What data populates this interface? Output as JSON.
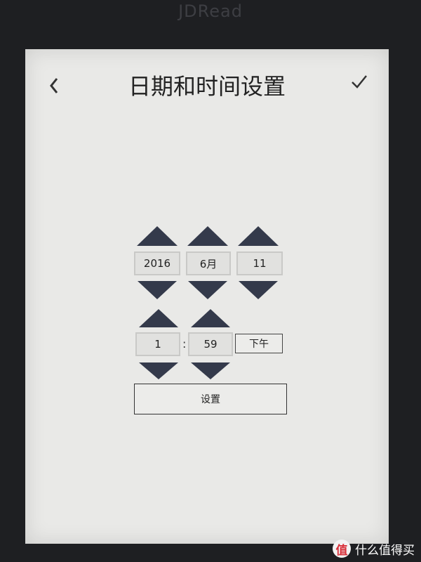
{
  "device": {
    "brand": "JDRead"
  },
  "header": {
    "title": "日期和时间设置"
  },
  "date": {
    "year": "2016",
    "month": "6月",
    "day": "11"
  },
  "time": {
    "hour": "1",
    "separator": ":",
    "minute": "59",
    "period": "下午"
  },
  "actions": {
    "set_label": "设置"
  },
  "watermark": {
    "logo_char": "值",
    "text": "什么值得买"
  },
  "icons": {
    "back": "chevron-left-icon",
    "confirm": "checkmark-icon",
    "up": "triangle-up-icon",
    "down": "triangle-down-icon"
  },
  "colors": {
    "bezel": "#1e1f22",
    "screen": "#e9e9e7",
    "triangle": "#343a4b"
  }
}
